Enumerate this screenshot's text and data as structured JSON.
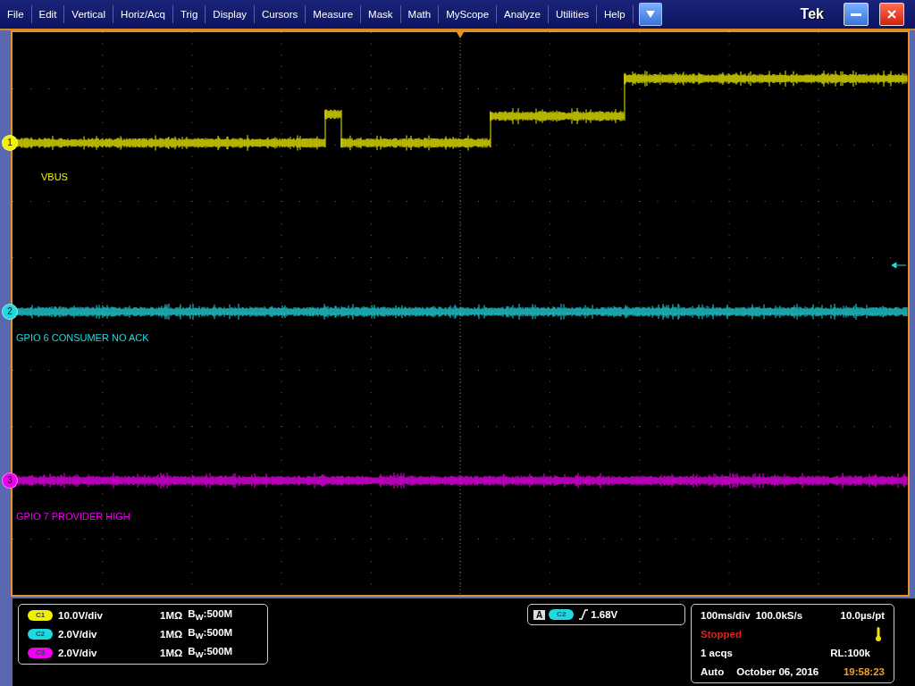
{
  "menu": [
    "File",
    "Edit",
    "Vertical",
    "Horiz/Acq",
    "Trig",
    "Display",
    "Cursors",
    "Measure",
    "Mask",
    "Math",
    "MyScope",
    "Analyze",
    "Utilities",
    "Help"
  ],
  "brand": "Tek",
  "channels": [
    {
      "number": "1",
      "label": "VBUS",
      "color": "#f0f000",
      "badge": "C1",
      "scale": "10.0V/div",
      "impedance": "1MΩ",
      "bandwidth": "B$_{W}$:500M"
    },
    {
      "number": "2",
      "label": "GPIO 6 CONSUMER NO ACK",
      "color": "#20d8e0",
      "badge": "C2",
      "scale": "2.0V/div",
      "impedance": "1MΩ",
      "bandwidth": "B$_{W}$:500M"
    },
    {
      "number": "3",
      "label": "GPIO 7 PROVIDER HIGH",
      "color": "#f000f0",
      "badge": "C3",
      "scale": "2.0V/div",
      "impedance": "1MΩ",
      "bandwidth": "B$_{W}$:500M"
    }
  ],
  "trigger": {
    "mode": "A",
    "source": "C2",
    "level": "1.68V"
  },
  "acquisition": {
    "timebase": "100ms/div",
    "sample_rate": "100.0kS/s",
    "resolution": "10.0µs/pt",
    "state": "Stopped",
    "acqs": "1 acqs",
    "record_length": "RL:100k",
    "trigger_mode": "Auto",
    "date": "October 06, 2016",
    "time": "19:58:23"
  }
}
